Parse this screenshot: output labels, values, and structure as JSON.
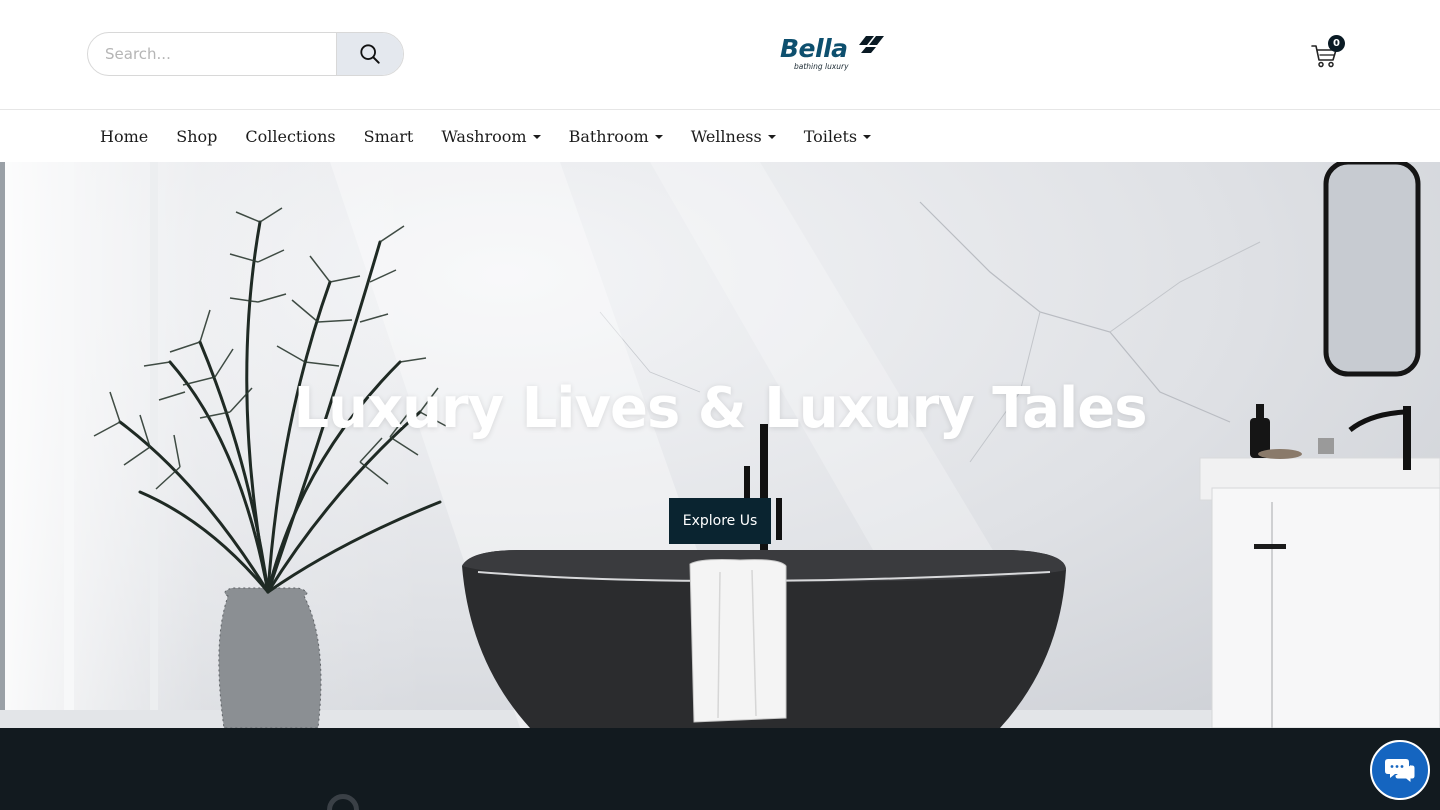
{
  "header": {
    "search": {
      "placeholder": "Search...",
      "value": ""
    },
    "logo": {
      "name": "Bella",
      "tagline": "bathing luxury"
    },
    "cart": {
      "count": "0"
    }
  },
  "nav": {
    "items": [
      {
        "label": "Home",
        "dropdown": false
      },
      {
        "label": "Shop",
        "dropdown": false
      },
      {
        "label": "Collections",
        "dropdown": false
      },
      {
        "label": "Smart",
        "dropdown": false
      },
      {
        "label": "Washroom",
        "dropdown": true
      },
      {
        "label": "Bathroom",
        "dropdown": true
      },
      {
        "label": "Wellness",
        "dropdown": true
      },
      {
        "label": "Toilets",
        "dropdown": true
      }
    ]
  },
  "hero": {
    "title": "Luxury Lives & Luxury Tales",
    "cta_label": "Explore Us"
  },
  "icons": {
    "search": "search-icon",
    "cart": "cart-icon",
    "chat": "chat-icon",
    "caret": "caret-down-icon"
  },
  "colors": {
    "brand": "#0d4f6e",
    "button_dark": "#0a2430",
    "dark_band": "#121a1f",
    "chat": "#1565c0"
  }
}
